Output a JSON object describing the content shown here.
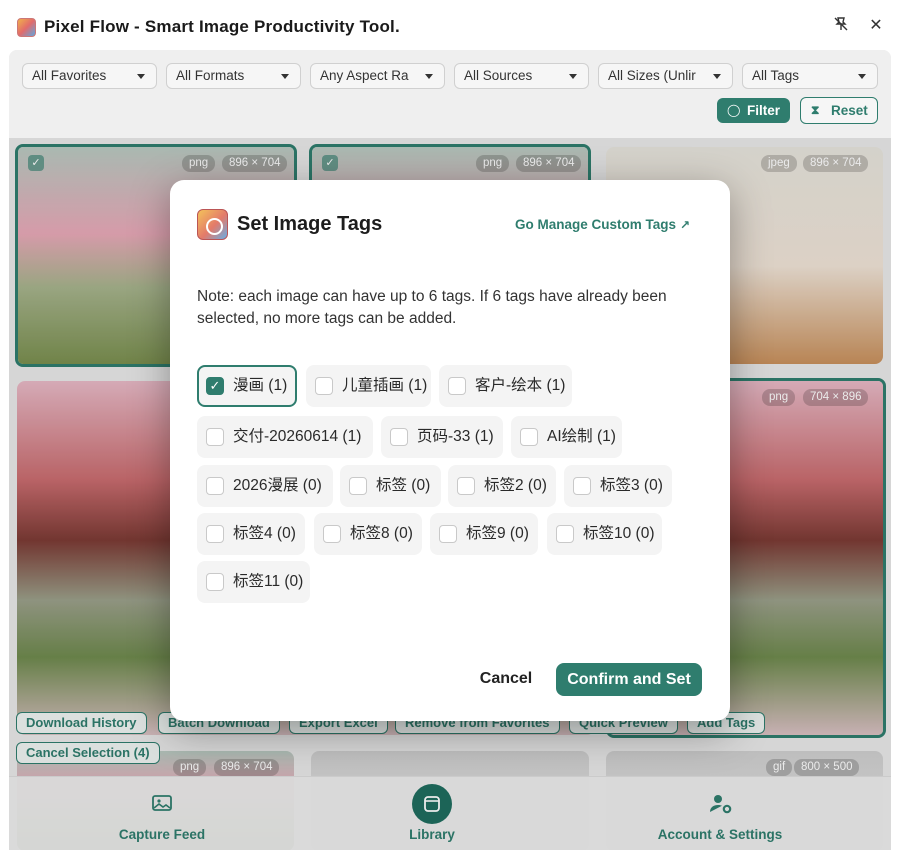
{
  "window": {
    "title": "Pixel Flow - Smart Image Productivity Tool.",
    "pin_icon": "pin-off-icon",
    "close_icon": "close-icon"
  },
  "filters": {
    "selects": [
      "All Favorites",
      "All Formats",
      "Any Aspect Ra",
      "All Sources",
      "All Sizes (Unlir",
      "All Tags"
    ],
    "filter_label": "Filter",
    "reset_label": "Reset"
  },
  "tiles": [
    {
      "format": "png",
      "size": "896 × 704",
      "selected": true
    },
    {
      "format": "png",
      "size": "896 × 704",
      "selected": true
    },
    {
      "format": "jpeg",
      "size": "896 × 704",
      "selected": false
    },
    {
      "format": "png",
      "size": "704 × 896",
      "selected": true
    },
    {
      "format": "png",
      "size": "896 × 704",
      "selected": false
    },
    {
      "format": "gif",
      "size": "800 × 500",
      "selected": false
    }
  ],
  "actions": [
    "Download History",
    "Batch Download",
    "Export Excel",
    "Remove from Favorites",
    "Quick Preview",
    "Add Tags",
    "Cancel Selection (4)"
  ],
  "bottom_nav": [
    {
      "label": "Capture Feed",
      "icon": "image-icon",
      "active": false
    },
    {
      "label": "Library",
      "icon": "library-icon",
      "active": true
    },
    {
      "label": "Account & Settings",
      "icon": "user-settings-icon",
      "active": false
    }
  ],
  "dialog": {
    "title": "Set Image Tags",
    "manage_link": "Go Manage Custom Tags",
    "note": "Note: each image can have up to 6 tags. If 6 tags have already been selected, no more tags can be added.",
    "tags": [
      {
        "label": "漫画 (1)",
        "checked": true
      },
      {
        "label": "儿童插画 (1)",
        "checked": false
      },
      {
        "label": "客户-绘本 (1)",
        "checked": false
      },
      {
        "label": "交付-20260614 (1)",
        "checked": false
      },
      {
        "label": "页码-33 (1)",
        "checked": false
      },
      {
        "label": "AI绘制 (1)",
        "checked": false
      },
      {
        "label": "2026漫展 (0)",
        "checked": false
      },
      {
        "label": "标签 (0)",
        "checked": false
      },
      {
        "label": "标签2 (0)",
        "checked": false
      },
      {
        "label": "标签3 (0)",
        "checked": false
      },
      {
        "label": "标签4 (0)",
        "checked": false
      },
      {
        "label": "标签8 (0)",
        "checked": false
      },
      {
        "label": "标签9 (0)",
        "checked": false
      },
      {
        "label": "标签10 (0)",
        "checked": false
      },
      {
        "label": "标签11 (0)",
        "checked": false
      }
    ],
    "cancel_label": "Cancel",
    "confirm_label": "Confirm and Set"
  },
  "colors": {
    "accent": "#2f7d6e",
    "accent_dark": "#1f6d5f"
  }
}
